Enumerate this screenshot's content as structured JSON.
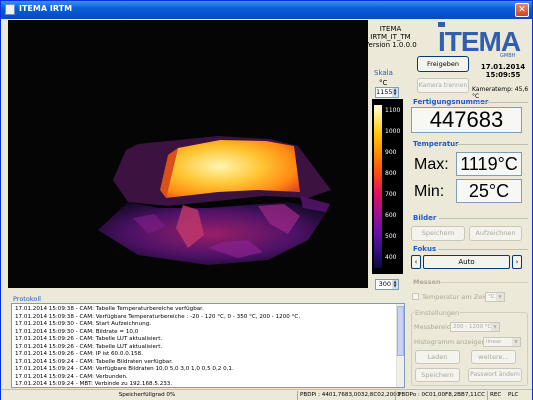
{
  "window": {
    "title": "ITEMA IRTM",
    "close_glyph": "✕"
  },
  "branding": {
    "line1": "ITEMA",
    "line2": "IRTM_IT_TM",
    "line3": "Version 1.0.0.0",
    "logo_text": "ITEMA",
    "logo_sub": "GMBH"
  },
  "scale": {
    "label": "Skala",
    "unit": "°C",
    "max_value": "1155",
    "min_value": "300",
    "ticks": [
      "1100",
      "1000",
      "900",
      "800",
      "700",
      "600",
      "500",
      "400",
      "300"
    ]
  },
  "controls": {
    "freigeben_label": "Freigeben",
    "kamera_trennen_label": "Kamera trennen"
  },
  "datetime": {
    "date": "17.01.2014",
    "time": "15:09:55",
    "kamera_temp": "Kameratemp: 45,6 °C"
  },
  "fertigung": {
    "title": "Fertigungsnummer",
    "value": "447683"
  },
  "temperatur": {
    "title": "Temperatur",
    "max_label": "Max:",
    "max_value": "1119°C",
    "min_label": "Min:",
    "min_value": "25°C"
  },
  "bilder": {
    "title": "Bilder",
    "speichern_label": "Speichern",
    "aufzeichnen_label": "Aufzeichnen"
  },
  "fokus": {
    "title": "Fokus",
    "left_arrow": "‹",
    "mode_label": "Auto",
    "right_arrow": "›"
  },
  "messen": {
    "title": "Messen",
    "checkbox_label": "Temperatur am Zeiger in",
    "unit_value": "°C"
  },
  "einstellungen": {
    "title": "Einstellungen",
    "messbereich_label": "Messbereich",
    "messbereich_value": "200 - 1200 °C",
    "histogramm_label": "Histogramm anzeigen",
    "histogramm_value": "linear",
    "laden_label": "Laden",
    "weitere_label": "weitere...",
    "speichern_label": "Speichern",
    "passwort_label": "Passwort ändern"
  },
  "protokoll": {
    "title": "Protokoll",
    "lines": [
      "17.01.2014 15:09:38 - CAM: Tabelle Temperaturbereiche verfügbar.",
      "17.01.2014 15:09:38 - CAM: Verfügbare Temperaturbereiche : -20 - 120 °C, 0 - 350 °C, 200 - 1200 °C.",
      "17.01.2014 15:09:30 - CAM: Start Aufzeichnung.",
      "17.01.2014 15:09:30 - CAM: Bildrate = 10,0",
      "17.01.2014 15:09:26 - CAM: Tabelle LUT aktualisiert.",
      "17.01.2014 15:09:26 - CAM: Tabelle LUT aktualisiert.",
      "17.01.2014 15:09:26 - CAM: IP ist 60.0.0.158.",
      "17.01.2014 15:09:24 - CAM: Tabelle Bildraten verfügbar.",
      "17.01.2014 15:09:24 - CAM: Verfügbare Bildraten 10,0 5,0 3,0 1,0 0,5 0,2 0,1.",
      "17.01.2014 15:09:24 - CAM: Verbunden.",
      "17.01.2014 15:09:24 - MBT: Verbinde zu 192.168.5.233."
    ]
  },
  "status": {
    "speicher": "Speicherfüllgrad 0%",
    "pbdpi": "PBDPi : 4401,7683,0032,8C02,2003",
    "pbdpo": "PBDPo : 0C01,00F8,2BB7,11CC",
    "rec": "REC",
    "plc": "PLC"
  },
  "colors": {
    "accent": "#1e5bc6",
    "titlebar": "#0a5fd8",
    "logo": "#2f5fae"
  }
}
